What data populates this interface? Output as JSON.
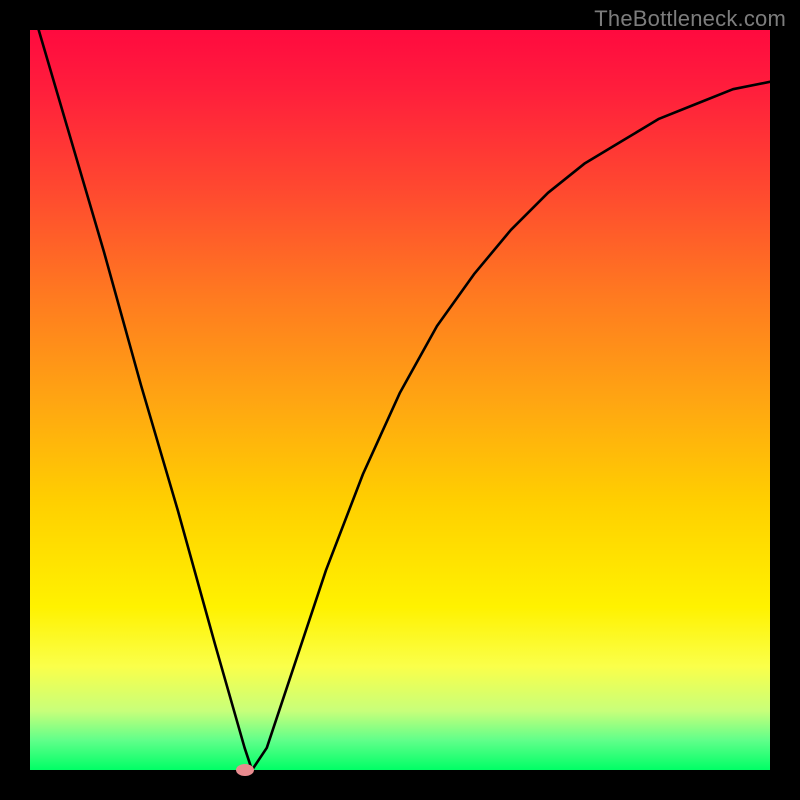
{
  "watermark": "TheBottleneck.com",
  "chart_data": {
    "type": "line",
    "title": "",
    "xlabel": "",
    "ylabel": "",
    "xlim": [
      0,
      100
    ],
    "ylim": [
      0,
      100
    ],
    "series": [
      {
        "name": "bottleneck-curve",
        "x": [
          0,
          5,
          10,
          15,
          20,
          25,
          29,
          30,
          32,
          35,
          40,
          45,
          50,
          55,
          60,
          65,
          70,
          75,
          80,
          85,
          90,
          95,
          100
        ],
        "values": [
          104,
          87,
          70,
          52,
          35,
          17,
          3,
          0,
          3,
          12,
          27,
          40,
          51,
          60,
          67,
          73,
          78,
          82,
          85,
          88,
          90,
          92,
          93
        ]
      }
    ],
    "marker": {
      "x": 29,
      "y": 0,
      "color": "#e98b8f"
    },
    "background_gradient": {
      "top": "#ff0a3f",
      "mid": "#ffd000",
      "bottom": "#00ff66"
    },
    "grid": false
  }
}
